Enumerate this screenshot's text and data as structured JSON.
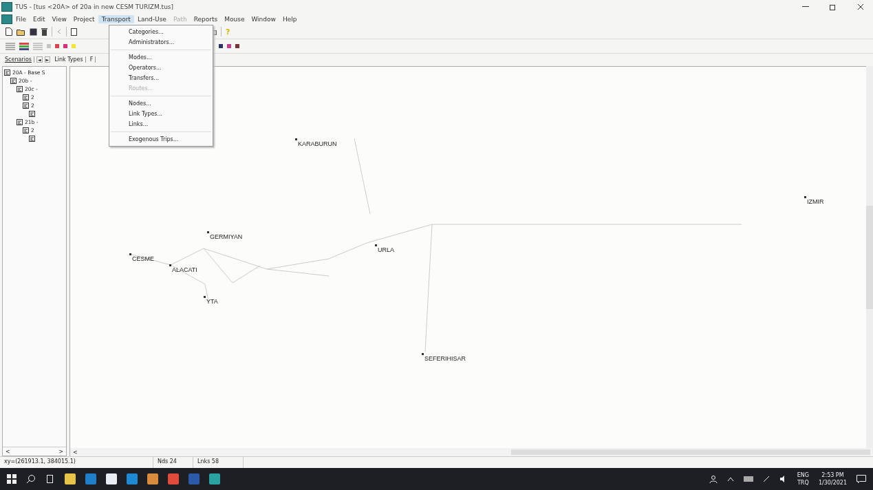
{
  "window": {
    "title": "TUS - [tus <20A> of 20a in new CESM TURIZM.tus]"
  },
  "menu_bar": [
    {
      "label": "File",
      "selected": false,
      "disabled": false
    },
    {
      "label": "Edit",
      "selected": false,
      "disabled": false
    },
    {
      "label": "View",
      "selected": false,
      "disabled": false
    },
    {
      "label": "Project",
      "selected": false,
      "disabled": false
    },
    {
      "label": "Transport",
      "selected": true,
      "disabled": false
    },
    {
      "label": "Land-Use",
      "selected": false,
      "disabled": false
    },
    {
      "label": "Path",
      "selected": false,
      "disabled": true
    },
    {
      "label": "Reports",
      "selected": false,
      "disabled": false
    },
    {
      "label": "Mouse",
      "selected": false,
      "disabled": false
    },
    {
      "label": "Window",
      "selected": false,
      "disabled": false
    },
    {
      "label": "Help",
      "selected": false,
      "disabled": false
    }
  ],
  "dropdown": [
    {
      "kind": "item",
      "label": "Categories...",
      "disabled": false
    },
    {
      "kind": "item",
      "label": "Administrators...",
      "disabled": false
    },
    {
      "kind": "separator"
    },
    {
      "kind": "item",
      "label": "Modes...",
      "disabled": false
    },
    {
      "kind": "item",
      "label": "Operators...",
      "disabled": false
    },
    {
      "kind": "item",
      "label": "Transfers...",
      "disabled": false
    },
    {
      "kind": "item",
      "label": "Routes...",
      "disabled": true
    },
    {
      "kind": "separator"
    },
    {
      "kind": "item",
      "label": "Nodes...",
      "disabled": false
    },
    {
      "kind": "item",
      "label": "Link Types...",
      "disabled": false
    },
    {
      "kind": "item",
      "label": "Links...",
      "disabled": false
    },
    {
      "kind": "separator"
    },
    {
      "kind": "item",
      "label": "Exogenous Trips...",
      "disabled": false
    }
  ],
  "help_button": {
    "label": "?"
  },
  "swatches_left": [
    {
      "color": "#c4c4c4"
    },
    {
      "color": "#d9434a"
    },
    {
      "color": "#d6307a"
    },
    {
      "color": "#f2e533"
    }
  ],
  "swatches_right": [
    {
      "color": "#2b3466"
    },
    {
      "color": "#c23f8e"
    },
    {
      "color": "#7a3438"
    }
  ],
  "tabs": [
    {
      "label": "Scenarios",
      "selected": true
    },
    {
      "label": "Link Types",
      "selected": false
    },
    {
      "label": "F",
      "selected": false
    }
  ],
  "tab_scroll": [
    "◄",
    "►"
  ],
  "tree": [
    {
      "kind": "labeled",
      "label": "20A - Base S",
      "children": [
        {
          "kind": "labeled",
          "label": "20b -",
          "children": [
            {
              "kind": "labeled",
              "label": "20c -",
              "children": [
                {
                  "kind": "labeled",
                  "label": "2"
                },
                {
                  "kind": "labeled",
                  "label": "2",
                  "children": [
                    {
                      "kind": "unlabeled"
                    }
                  ]
                }
              ]
            },
            {
              "kind": "labeled",
              "label": "21b -",
              "children": [
                {
                  "kind": "labeled",
                  "label": "2",
                  "children": [
                    {
                      "kind": "unlabeled"
                    }
                  ]
                }
              ]
            }
          ]
        }
      ]
    }
  ],
  "tree_scroll": [
    "<",
    ">"
  ],
  "map_scroll": [
    "<"
  ],
  "map": {
    "nodes": [
      {
        "label": "KARABURUN"
      },
      {
        "label": "IZMIR"
      },
      {
        "label": "GERMIYAN"
      },
      {
        "label": "CESME"
      },
      {
        "label": "ALACATI"
      },
      {
        "label": "URLA"
      },
      {
        "label": "YTA"
      },
      {
        "label": "SEFERIHISAR"
      }
    ]
  },
  "status_bar": [
    "xy=(261913.1, 384015.1)",
    "Nds 24",
    "Lnks 58"
  ],
  "taskbar": {
    "input_lang": "ENG",
    "keyboard": "TRQ",
    "time": "2:53 PM",
    "date": "1/30/2021"
  }
}
